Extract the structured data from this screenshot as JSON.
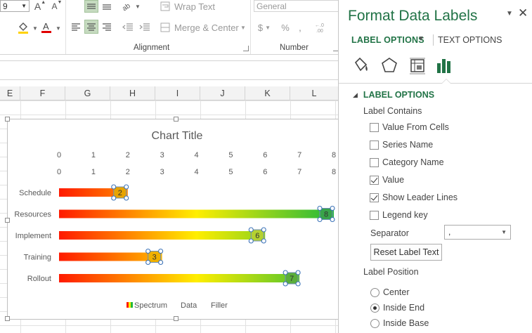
{
  "ribbon": {
    "font_size_value": "9",
    "grow_font": "A",
    "shrink_font": "A",
    "wrap_text": "Wrap Text",
    "merge_center": "Merge & Center",
    "number_format": "General",
    "currency_symbol": "$",
    "percent_symbol": "%",
    "group_alignment": "Alignment",
    "group_number": "Number"
  },
  "sheet": {
    "columns": [
      {
        "label": "E",
        "w": 29
      },
      {
        "label": "F",
        "w": 64
      },
      {
        "label": "G",
        "w": 64
      },
      {
        "label": "H",
        "w": 64
      },
      {
        "label": "I",
        "w": 64
      },
      {
        "label": "J",
        "w": 64
      },
      {
        "label": "K",
        "w": 64
      },
      {
        "label": "L",
        "w": 69
      }
    ]
  },
  "chart_data": {
    "type": "bar",
    "orientation": "horizontal",
    "title": "Chart Title",
    "categories": [
      "Schedule",
      "Resources",
      "Implement",
      "Training",
      "Rollout"
    ],
    "values": [
      2,
      8,
      6,
      3,
      7
    ],
    "x_ticks_top_1": [
      0,
      1,
      2,
      3,
      4,
      5,
      6,
      7,
      8
    ],
    "x_ticks_top_2": [
      0,
      1,
      2,
      3,
      4,
      5,
      6,
      7,
      8
    ],
    "xlim": [
      0,
      8
    ],
    "legend": [
      "Spectrum",
      "Data",
      "Filler"
    ],
    "legend_position": "bottom",
    "bar_gradient": [
      "#ff1a00",
      "#ffee00",
      "#22b83a"
    ],
    "label_fill_colors": [
      "#e8a400",
      "#38a44a",
      "#b5d130",
      "#f0b000",
      "#5aae3a"
    ]
  },
  "pane": {
    "title": "Format Data Labels",
    "tab_label_options": "LABEL OPTIONS",
    "tab_text_options": "TEXT OPTIONS",
    "icons": [
      "fill-line-icon",
      "effects-pentagon-icon",
      "size-properties-icon",
      "label-options-chart-icon"
    ],
    "section_title": "LABEL OPTIONS",
    "label_contains": "Label Contains",
    "checkboxes": [
      {
        "label": "Value From Cells",
        "checked": false
      },
      {
        "label": "Series Name",
        "checked": false
      },
      {
        "label": "Category Name",
        "checked": false
      },
      {
        "label": "Value",
        "checked": true
      },
      {
        "label": "Show Leader Lines",
        "checked": true
      },
      {
        "label": "Legend key",
        "checked": false
      }
    ],
    "separator_label": "Separator",
    "separator_value": ",",
    "reset_button": "Reset Label Text",
    "label_position": "Label Position",
    "radios": [
      {
        "label": "Center",
        "checked": false
      },
      {
        "label": "Inside End",
        "checked": true
      },
      {
        "label": "Inside Base",
        "checked": false
      }
    ],
    "accent_color": "#217346"
  }
}
